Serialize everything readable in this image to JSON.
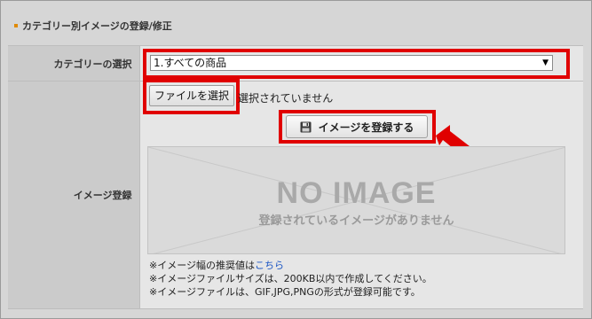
{
  "section_title": "カテゴリー別イメージの登録/修正",
  "category_row": {
    "label": "カテゴリーの選択",
    "selected": "1.すべての商品"
  },
  "image_row": {
    "label": "イメージ登録",
    "file_button": "ファイルを選択",
    "file_status": "選択されていません",
    "register_button": "イメージを登録する",
    "no_image_title": "NO IMAGE",
    "no_image_sub": "登録されているイメージがありません",
    "note1_prefix": "※イメージ幅の推奨値は",
    "note1_link": "こちら",
    "note2": "※イメージファイルサイズは、200KB以内で作成してください。",
    "note3": "※イメージファイルは、GIF,JPG,PNGの形式が登録可能です。"
  },
  "colors": {
    "highlight": "#e00000",
    "accent_bullet": "#e08a00",
    "link": "#1a55c4"
  },
  "icons": [
    "floppy-disk-icon",
    "dropdown-arrow-icon",
    "pointer-arrow-icon"
  ]
}
